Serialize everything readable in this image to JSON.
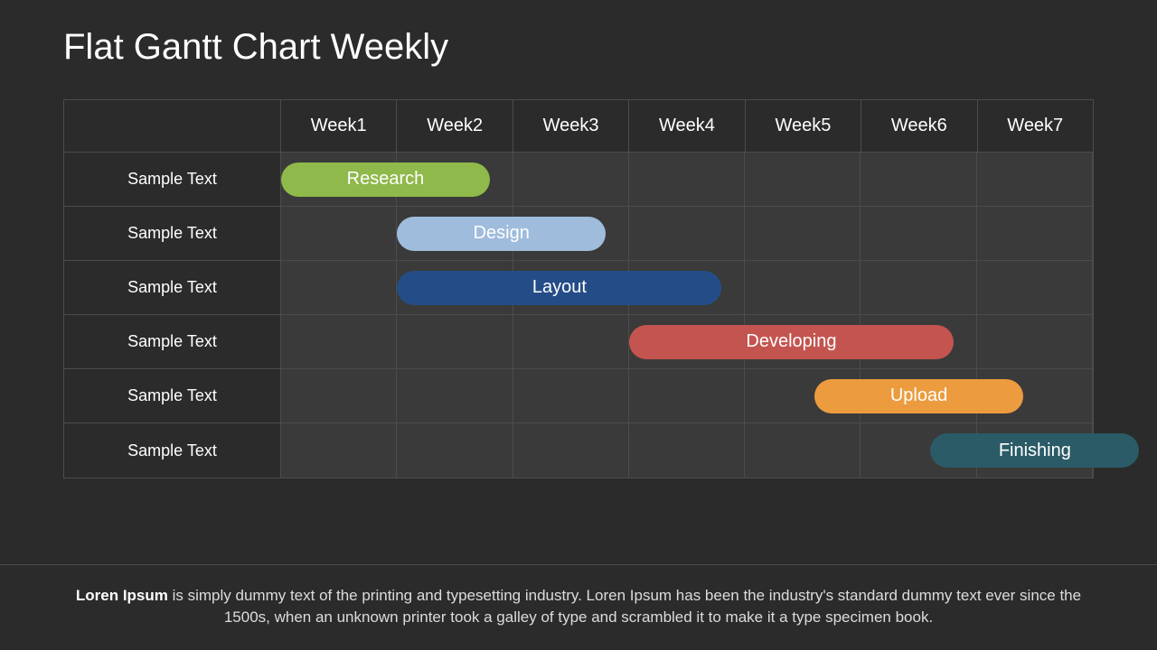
{
  "title": "Flat Gantt Chart Weekly",
  "weeks": [
    "Week1",
    "Week2",
    "Week3",
    "Week4",
    "Week5",
    "Week6",
    "Week7"
  ],
  "rows": [
    {
      "label": "Sample Text",
      "bar": {
        "label": "Research",
        "start": 0.0,
        "span": 1.8,
        "color": "#8fb94a"
      }
    },
    {
      "label": "Sample Text",
      "bar": {
        "label": "Design",
        "start": 1.0,
        "span": 1.8,
        "color": "#9fbcdc"
      }
    },
    {
      "label": "Sample Text",
      "bar": {
        "label": "Layout",
        "start": 1.0,
        "span": 2.8,
        "color": "#244d87"
      }
    },
    {
      "label": "Sample Text",
      "bar": {
        "label": "Developing",
        "start": 3.0,
        "span": 2.8,
        "color": "#c4544f"
      }
    },
    {
      "label": "Sample Text",
      "bar": {
        "label": "Upload",
        "start": 4.6,
        "span": 1.8,
        "color": "#ec9c3f"
      }
    },
    {
      "label": "Sample Text",
      "bar": {
        "label": "Finishing",
        "start": 5.6,
        "span": 1.8,
        "color": "#2a5b66"
      }
    }
  ],
  "footer": {
    "bold": "Loren Ipsum",
    "rest": " is simply dummy text of the printing and typesetting industry. Loren Ipsum has been the industry's standard dummy text ever since the 1500s, when an unknown printer took a galley of type and scrambled it to make it a type specimen book."
  },
  "chart_data": {
    "type": "bar",
    "title": "Flat Gantt Chart Weekly",
    "xlabel": "",
    "ylabel": "",
    "categories": [
      "Week1",
      "Week2",
      "Week3",
      "Week4",
      "Week5",
      "Week6",
      "Week7"
    ],
    "series": [
      {
        "name": "Research",
        "start": 1,
        "end": 2.8,
        "row": "Sample Text",
        "color": "#8fb94a"
      },
      {
        "name": "Design",
        "start": 2,
        "end": 3.8,
        "row": "Sample Text",
        "color": "#9fbcdc"
      },
      {
        "name": "Layout",
        "start": 2,
        "end": 4.8,
        "row": "Sample Text",
        "color": "#244d87"
      },
      {
        "name": "Developing",
        "start": 4,
        "end": 6.8,
        "row": "Sample Text",
        "color": "#c4544f"
      },
      {
        "name": "Upload",
        "start": 5.6,
        "end": 7.4,
        "row": "Sample Text",
        "color": "#ec9c3f"
      },
      {
        "name": "Finishing",
        "start": 6.6,
        "end": 8.4,
        "row": "Sample Text",
        "color": "#2a5b66"
      }
    ],
    "xlim": [
      1,
      7
    ]
  }
}
